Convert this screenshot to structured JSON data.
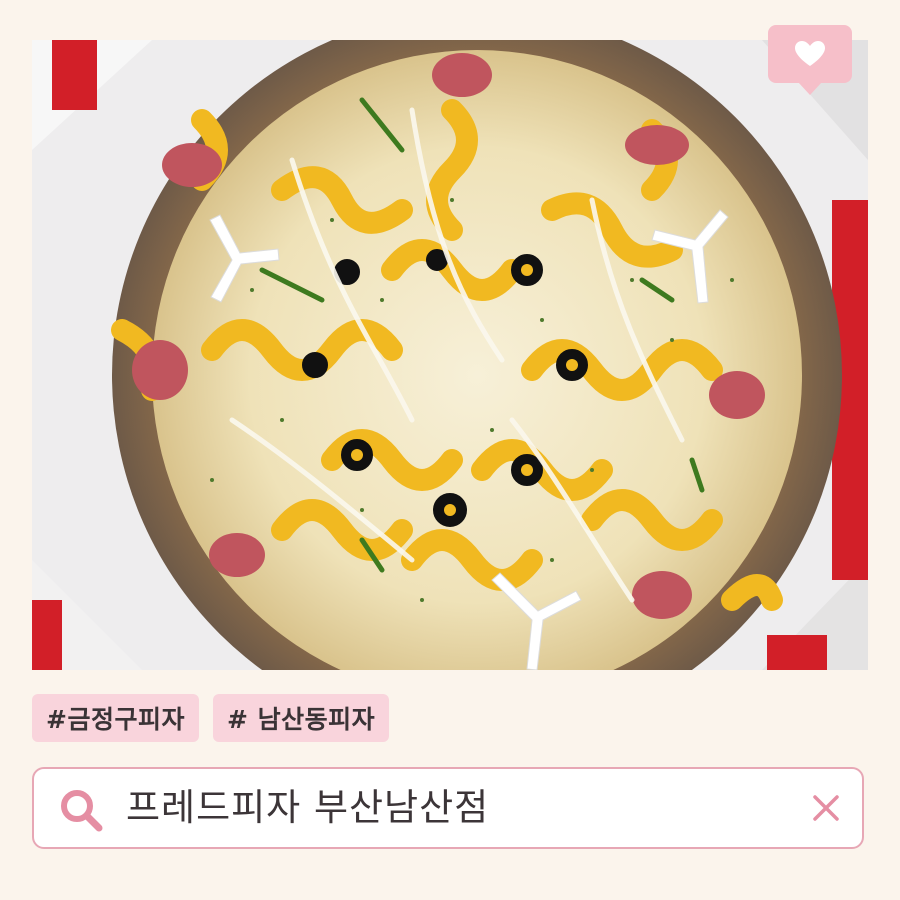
{
  "photo": {
    "description_icon": "pizza-photo"
  },
  "badge": {
    "icon": "heart-icon",
    "color": "#f6bfc9"
  },
  "tags": [
    {
      "label": "#금정구피자"
    },
    {
      "label": "# 남산동피자"
    }
  ],
  "search": {
    "query": "프레드피자 부산남산점",
    "search_icon": "search-icon",
    "clear_icon": "close-icon",
    "accent_color": "#e58ea3"
  }
}
